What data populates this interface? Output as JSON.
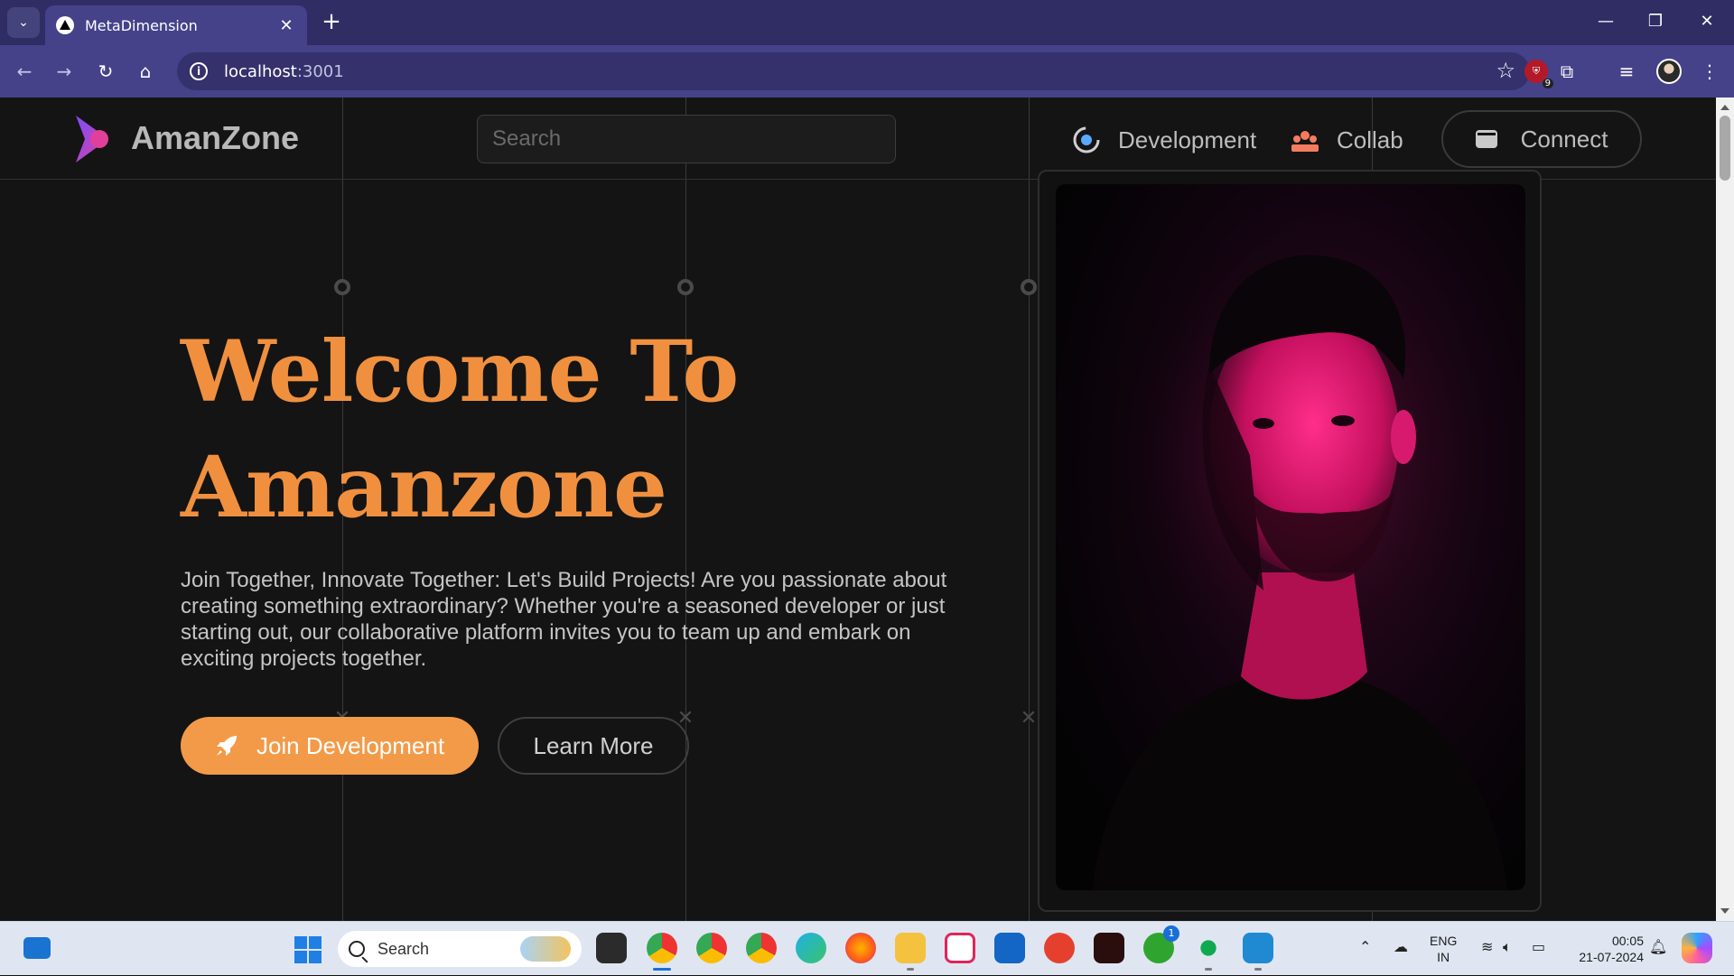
{
  "browser": {
    "tab_title": "MetaDimension",
    "tab_close": "✕",
    "new_tab": "+",
    "url_host": "localhost",
    "url_port": ":3001",
    "minimize": "—",
    "restore": "❐",
    "close": "✕",
    "extension_badge_count": "9"
  },
  "header": {
    "brand": "AmanZone",
    "search_placeholder": "Search",
    "nav": [
      {
        "label": "Development",
        "icon": "orbit-icon"
      },
      {
        "label": "Collab",
        "icon": "team-icon"
      }
    ],
    "connect_label": "Connect"
  },
  "hero": {
    "title_line1": "Welcome To",
    "title_line2": "Amanzone",
    "description": "Join Together, Innovate Together: Let's Build Projects! Are you passionate about creating something extraordinary? Whether you're a seasoned developer or just starting out, our collaborative platform invites you to team up and embark on exciting projects together.",
    "primary_button": "Join Development",
    "secondary_button": "Learn More",
    "accent_color": "#f39a48"
  },
  "taskbar": {
    "search_label": "Search",
    "lang_line1": "ENG",
    "lang_line2": "IN",
    "time": "00:05",
    "date": "21-07-2024",
    "xbox_badge": "1"
  }
}
